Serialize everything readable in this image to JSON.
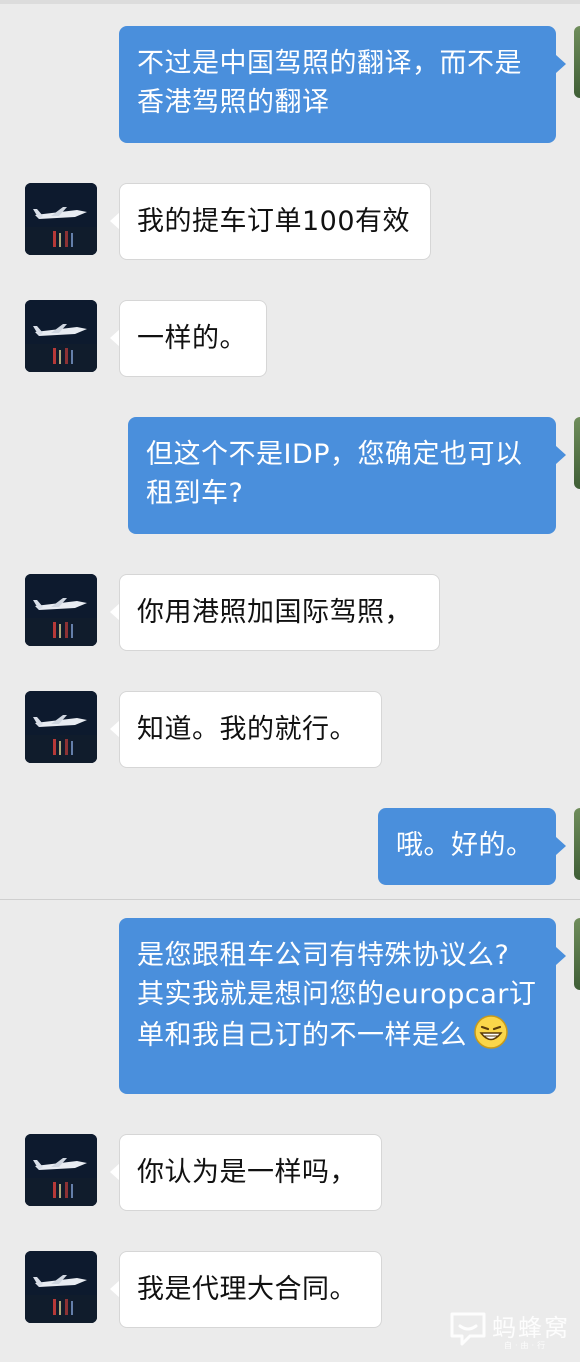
{
  "messages": [
    {
      "side": "right",
      "lines": [
        "不过是中国驾照的翻译，而不是",
        "香港驾照的翻译"
      ]
    },
    {
      "side": "left",
      "lines": [
        "我的提车订单100有效"
      ]
    },
    {
      "side": "left",
      "lines": [
        "一样的。"
      ]
    },
    {
      "side": "right",
      "lines": [
        "但这个不是IDP，您确定也可以",
        "租到车?"
      ]
    },
    {
      "side": "left",
      "lines": [
        "你用港照加国际驾照，"
      ]
    },
    {
      "side": "left",
      "lines": [
        "知道。我的就行。"
      ]
    },
    {
      "side": "right",
      "lines": [
        "哦。好的。"
      ]
    },
    {
      "side": "right",
      "lines": [
        "是您跟租车公司有特殊协议么?",
        "其实我就是想问您的europcar订",
        "单和我自己订的不一样是么"
      ],
      "emoji": "grinning-face-emoji"
    },
    {
      "side": "left",
      "lines": [
        "你认为是一样吗，"
      ]
    },
    {
      "side": "left",
      "lines": [
        "我是代理大合同。"
      ]
    }
  ],
  "avatar_icon": "jet-airplane-avatar",
  "watermark": {
    "text": "蚂蜂窝",
    "sub": "自·由·行"
  },
  "colors": {
    "background": "#ebebeb",
    "right_bubble": "#4a8fdc",
    "left_bubble": "#ffffff"
  }
}
